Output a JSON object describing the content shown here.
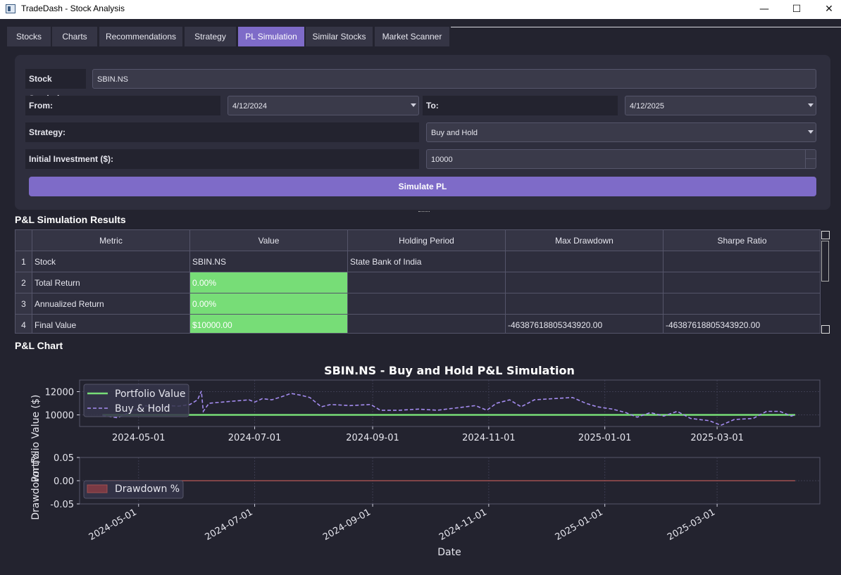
{
  "window": {
    "title": "TradeDash - Stock Analysis",
    "minimize": "—",
    "maximize": "☐",
    "close": "✕"
  },
  "tabs": [
    {
      "label": "Stocks"
    },
    {
      "label": "Charts"
    },
    {
      "label": "Recommendations"
    },
    {
      "label": "Strategy"
    },
    {
      "label": "PL Simulation",
      "active": true
    },
    {
      "label": "Similar Stocks"
    },
    {
      "label": "Market Scanner"
    }
  ],
  "form": {
    "symbol_label": "Stock Symbol:",
    "symbol_value": "SBIN.NS",
    "from_label": "From:",
    "from_value": "4/12/2024",
    "to_label": "To:",
    "to_value": "4/12/2025",
    "strategy_label": "Strategy:",
    "strategy_value": "Buy and Hold",
    "investment_label": "Initial Investment ($):",
    "investment_value": "10000",
    "simulate_button": "Simulate PL"
  },
  "results": {
    "title": "P&L Simulation Results",
    "columns": [
      "Metric",
      "Value",
      "Holding Period",
      "Max Drawdown",
      "Sharpe Ratio"
    ],
    "rows": [
      {
        "num": "1",
        "cells": [
          "Stock",
          "SBIN.NS",
          "State Bank of India",
          "",
          ""
        ]
      },
      {
        "num": "2",
        "cells": [
          "Total Return",
          "0.00%",
          "",
          "",
          ""
        ]
      },
      {
        "num": "3",
        "cells": [
          "Annualized Return",
          "0.00%",
          "",
          "",
          ""
        ]
      },
      {
        "num": "4",
        "cells": [
          "Final Value",
          "$10000.00",
          "",
          "-46387618805343920.00",
          "-46387618805343920.00"
        ]
      }
    ],
    "highlight_color": "#77dd77"
  },
  "chart_section_title": "P&L Chart",
  "chart_data": {
    "type": "line",
    "title": "SBIN.NS - Buy and Hold P&L Simulation",
    "top_panel": {
      "ylabel": "Portfolio Value ($)",
      "yticks": [
        10000,
        12000
      ],
      "ylim": [
        9000,
        13000
      ],
      "legend": [
        "Portfolio Value",
        "Buy & Hold"
      ],
      "legend_position": "top-left",
      "series": [
        {
          "name": "Portfolio Value",
          "color": "#77dd77",
          "style": "solid",
          "points": [
            [
              "2024-04-12",
              10000
            ],
            [
              "2025-04-11",
              10000
            ]
          ]
        },
        {
          "name": "Buy & Hold",
          "color": "#a48cf0",
          "style": "dashed",
          "points": [
            [
              "2024-04-12",
              9950
            ],
            [
              "2024-04-20",
              9750
            ],
            [
              "2024-04-28",
              10350
            ],
            [
              "2024-05-05",
              10800
            ],
            [
              "2024-05-10",
              10500
            ],
            [
              "2024-05-16",
              10800
            ],
            [
              "2024-05-22",
              10750
            ],
            [
              "2024-05-28",
              10900
            ],
            [
              "2024-06-01",
              11300
            ],
            [
              "2024-06-03",
              12050
            ],
            [
              "2024-06-04",
              10300
            ],
            [
              "2024-06-07",
              11000
            ],
            [
              "2024-06-14",
              11100
            ],
            [
              "2024-06-21",
              11200
            ],
            [
              "2024-06-28",
              11300
            ],
            [
              "2024-07-01",
              11100
            ],
            [
              "2024-07-05",
              11400
            ],
            [
              "2024-07-10",
              11300
            ],
            [
              "2024-07-15",
              11550
            ],
            [
              "2024-07-20",
              11850
            ],
            [
              "2024-07-25",
              11700
            ],
            [
              "2024-07-30",
              11500
            ],
            [
              "2024-08-05",
              10700
            ],
            [
              "2024-08-10",
              10900
            ],
            [
              "2024-08-20",
              10800
            ],
            [
              "2024-08-31",
              10900
            ],
            [
              "2024-09-05",
              10400
            ],
            [
              "2024-09-15",
              10400
            ],
            [
              "2024-09-25",
              10500
            ],
            [
              "2024-10-05",
              10400
            ],
            [
              "2024-10-15",
              10600
            ],
            [
              "2024-10-25",
              10800
            ],
            [
              "2024-10-31",
              10400
            ],
            [
              "2024-11-05",
              11000
            ],
            [
              "2024-11-12",
              11300
            ],
            [
              "2024-11-18",
              10700
            ],
            [
              "2024-11-25",
              11300
            ],
            [
              "2024-12-05",
              11400
            ],
            [
              "2024-12-15",
              11500
            ],
            [
              "2024-12-22",
              11000
            ],
            [
              "2024-12-28",
              10700
            ],
            [
              "2025-01-05",
              10500
            ],
            [
              "2025-01-12",
              10200
            ],
            [
              "2025-01-18",
              9800
            ],
            [
              "2025-01-25",
              10200
            ],
            [
              "2025-02-01",
              9900
            ],
            [
              "2025-02-08",
              10300
            ],
            [
              "2025-02-15",
              9700
            ],
            [
              "2025-02-25",
              9500
            ],
            [
              "2025-03-03",
              9100
            ],
            [
              "2025-03-10",
              9600
            ],
            [
              "2025-03-20",
              9700
            ],
            [
              "2025-03-27",
              10300
            ],
            [
              "2025-04-03",
              10300
            ],
            [
              "2025-04-09",
              9900
            ],
            [
              "2025-04-11",
              10000
            ]
          ]
        }
      ]
    },
    "bottom_panel": {
      "ylabel": "Drawdown (%",
      "yticks": [
        -0.05,
        0.0,
        0.05
      ],
      "ylim": [
        -0.05,
        0.05
      ],
      "legend": [
        "Drawdown %"
      ],
      "legend_position": "top-left",
      "series": [
        {
          "name": "Drawdown %",
          "color": "#a05050",
          "points": [
            [
              "2024-04-12",
              0
            ],
            [
              "2025-04-11",
              0
            ]
          ]
        }
      ]
    },
    "xlabel": "Date",
    "xticks": [
      "2024-05-01",
      "2024-07-01",
      "2024-09-01",
      "2024-11-01",
      "2025-01-01",
      "2025-03-01"
    ],
    "xlim": [
      "2024-03-31",
      "2025-04-24"
    ],
    "grid": true
  }
}
